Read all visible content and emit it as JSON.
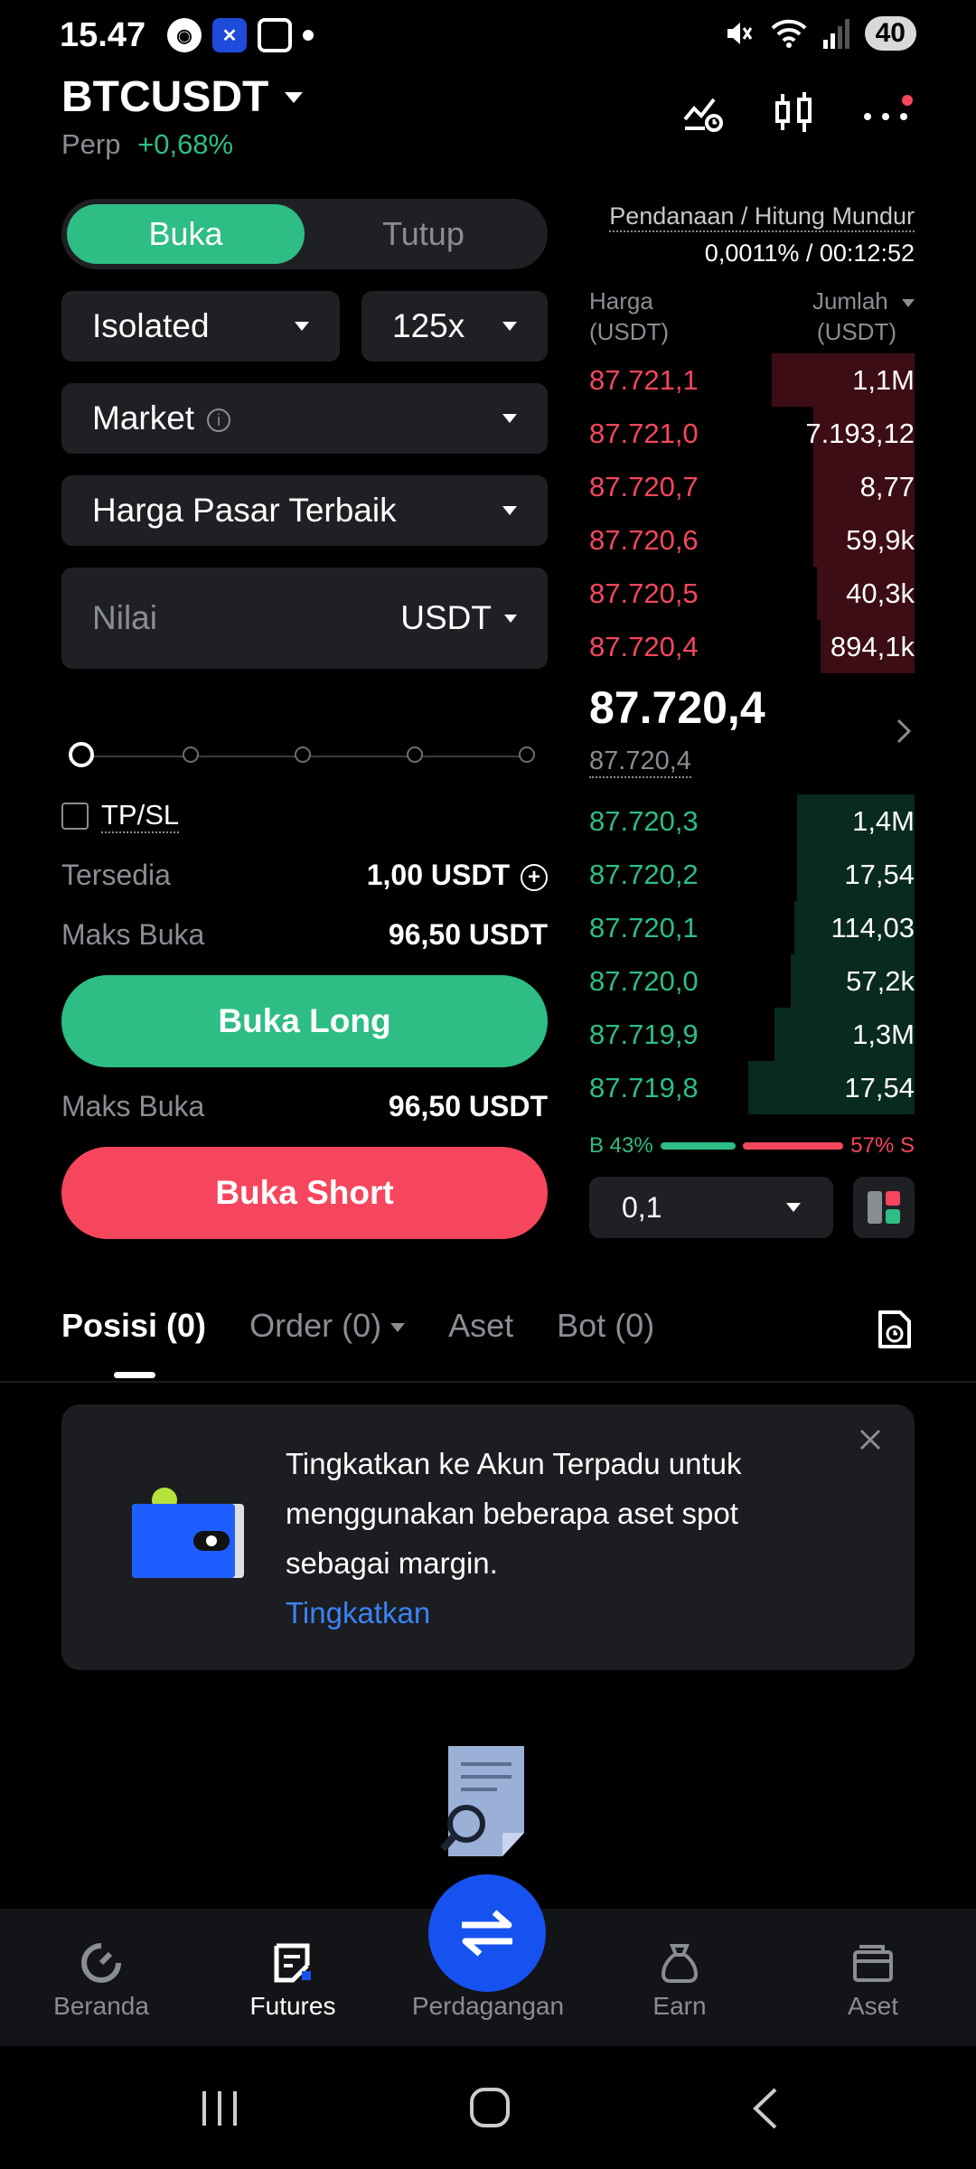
{
  "status_bar": {
    "time": "15.47",
    "battery": "40"
  },
  "header": {
    "symbol": "BTCUSDT",
    "contract_type": "Perp",
    "change": "+0,68%"
  },
  "form": {
    "tab_open": "Buka",
    "tab_close": "Tutup",
    "margin_mode": "Isolated",
    "leverage": "125x",
    "order_type": "Market",
    "price_mode": "Harga Pasar Terbaik",
    "value_placeholder": "Nilai",
    "value_unit": "USDT",
    "tpsl_label": "TP/SL",
    "available_label": "Tersedia",
    "available_value": "1,00 USDT",
    "max_open_label": "Maks Buka",
    "max_open_long": "96,50 USDT",
    "long_button": "Buka Long",
    "max_open_label_2": "Maks Buka",
    "max_open_short": "96,50 USDT",
    "short_button": "Buka Short"
  },
  "orderbook": {
    "funding_label": "Pendanaan / Hitung Mundur",
    "funding_value": "0,0011% / 00:12:52",
    "col_price": "Harga",
    "col_price_unit": "(USDT)",
    "col_amount": "Jumlah",
    "col_amount_unit": "(USDT)",
    "asks": [
      {
        "price": "87.721,1",
        "amount": "1,1M",
        "depth": 0.44
      },
      {
        "price": "87.721,0",
        "amount": "7.193,12",
        "depth": 0.31
      },
      {
        "price": "87.720,7",
        "amount": "8,77",
        "depth": 0.31
      },
      {
        "price": "87.720,6",
        "amount": "59,9k",
        "depth": 0.31
      },
      {
        "price": "87.720,5",
        "amount": "40,3k",
        "depth": 0.3
      },
      {
        "price": "87.720,4",
        "amount": "894,1k",
        "depth": 0.29
      }
    ],
    "last_price": "87.720,4",
    "mark_price": "87.720,4",
    "bids": [
      {
        "price": "87.720,3",
        "amount": "1,4M",
        "depth": 0.36
      },
      {
        "price": "87.720,2",
        "amount": "17,54",
        "depth": 0.36
      },
      {
        "price": "87.720,1",
        "amount": "114,03",
        "depth": 0.37
      },
      {
        "price": "87.720,0",
        "amount": "57,2k",
        "depth": 0.38
      },
      {
        "price": "87.719,9",
        "amount": "1,3M",
        "depth": 0.43
      },
      {
        "price": "87.719,8",
        "amount": "17,54",
        "depth": 0.51
      }
    ],
    "buy_ratio_label": "B 43%",
    "sell_ratio_label": "57% S",
    "buy_ratio": 0.43,
    "depth_step": "0,1"
  },
  "tabs": {
    "positions": "Posisi (0)",
    "orders": "Order (0)",
    "assets": "Aset",
    "bots": "Bot (0)"
  },
  "promo": {
    "text": "Tingkatkan ke Akun Terpadu untuk menggunakan beberapa aset spot sebagai margin.",
    "link": "Tingkatkan"
  },
  "nav": {
    "home": "Beranda",
    "futures": "Futures",
    "trade": "Perdagangan",
    "earn": "Earn",
    "assets": "Aset"
  },
  "colors": {
    "green": "#2ebd85",
    "red": "#f6465d",
    "blue": "#1652f0",
    "link": "#3b82f6"
  }
}
